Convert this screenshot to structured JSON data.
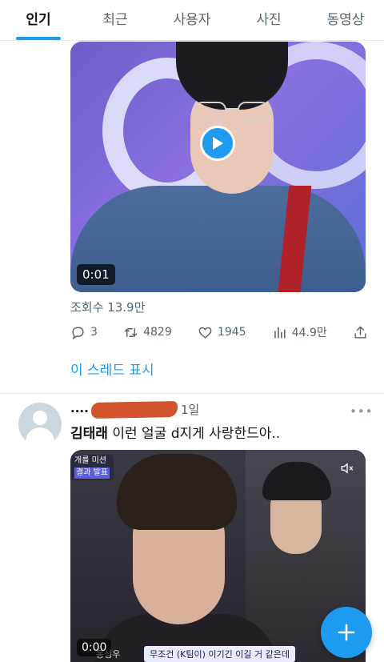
{
  "tabs": [
    {
      "label": "인기",
      "active": true
    },
    {
      "label": "최근",
      "active": false
    },
    {
      "label": "사용자",
      "active": false
    },
    {
      "label": "사진",
      "active": false
    },
    {
      "label": "동영상",
      "active": false
    }
  ],
  "tweet1": {
    "video_time": "0:01",
    "views": "조회수 13.9만",
    "replies": "3",
    "retweets": "4829",
    "likes": "1945",
    "analytics": "44.9만",
    "show_thread": "이 스레드 표시"
  },
  "tweet2": {
    "username": "....",
    "time": "1일",
    "text_bold": "김태래",
    "text_rest": " 이런 얼굴 d지게 사랑한드아..",
    "video_time": "0:00",
    "badge_line1": "개를 미션",
    "badge_line2": "결과 발표",
    "caption": "무조건 (K팀이) 이기긴 이길 거 같은데",
    "subtitle_name": "옹성우"
  },
  "colors": {
    "accent": "#1d9bf0",
    "muted": "#536471"
  }
}
